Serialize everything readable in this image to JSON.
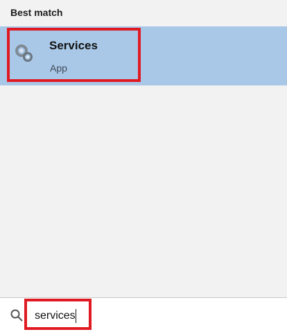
{
  "section": {
    "heading": "Best match"
  },
  "best_match": {
    "title": "Services",
    "subtitle": "App",
    "icon": "services-gear-icon",
    "highlight_color": "#a9c8e8"
  },
  "search": {
    "value": "services",
    "icon": "search-icon"
  },
  "annotation_color": "#e01a22"
}
